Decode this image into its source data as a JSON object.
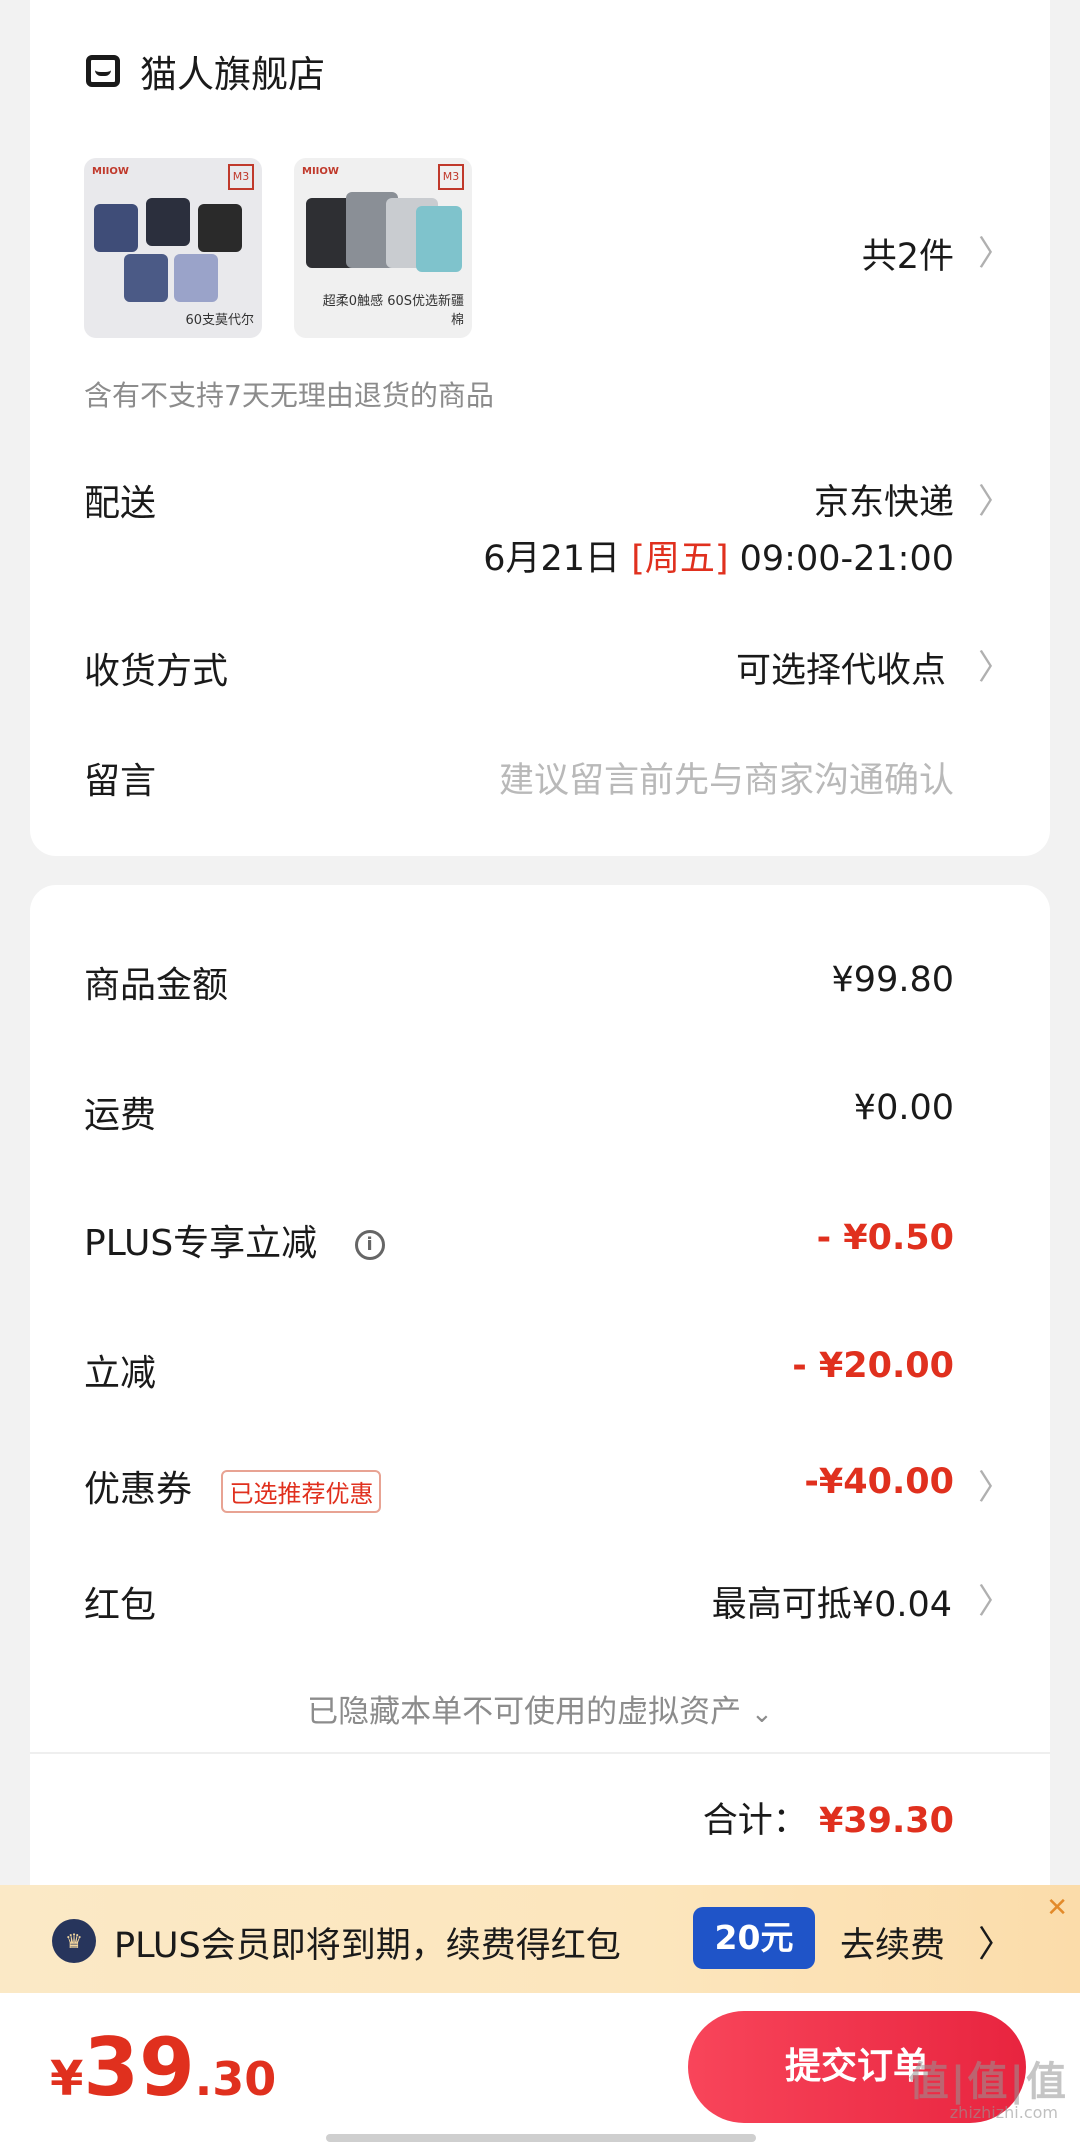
{
  "store": {
    "name": "猫人旗舰店"
  },
  "products": {
    "count_label": "共2件",
    "items": [
      {
        "brand": "MIIOW",
        "badge": "M3",
        "caption": "60支莫代尔"
      },
      {
        "brand": "MIIOW",
        "badge": "M3",
        "caption": "超柔0触感 60S优选新疆棉"
      }
    ],
    "notice": "含有不支持7天无理由退货的商品"
  },
  "delivery": {
    "label": "配送",
    "carrier": "京东快递",
    "date": "6月21日",
    "weekday": "[周五]",
    "time": "09:00-21:00"
  },
  "receive": {
    "label": "收货方式",
    "value": "可选择代收点"
  },
  "message": {
    "label": "留言",
    "placeholder": "建议留言前先与商家沟通确认"
  },
  "price": {
    "goods_label": "商品金额",
    "goods_value": "¥99.80",
    "shipping_label": "运费",
    "shipping_value": "¥0.00",
    "plus_label": "PLUS专享立减",
    "plus_value": "- ¥0.50",
    "instant_label": "立减",
    "instant_value": "- ¥20.00",
    "coupon_label": "优惠券",
    "coupon_tag": "已选推荐优惠",
    "coupon_value": "-¥40.00",
    "redpacket_label": "红包",
    "redpacket_value": "最高可抵¥0.04",
    "hidden_assets": "已隐藏本单不可使用的虚拟资产",
    "total_label": "合计：",
    "total_value": "¥39.30"
  },
  "plus_banner": {
    "text": "PLUS会员即将到期，续费得红包",
    "badge": "20元",
    "action": "去续费"
  },
  "bottom": {
    "yen": "¥",
    "int": "39",
    "dec": ".30",
    "submit": "提交订单"
  },
  "watermark": {
    "text": "值|值|值",
    "sub": "zhizhizhi.com"
  },
  "colors": {
    "accent_red": "#e0301e",
    "plus_blue": "#1f54c8",
    "submit_red": "#f03a4f"
  }
}
